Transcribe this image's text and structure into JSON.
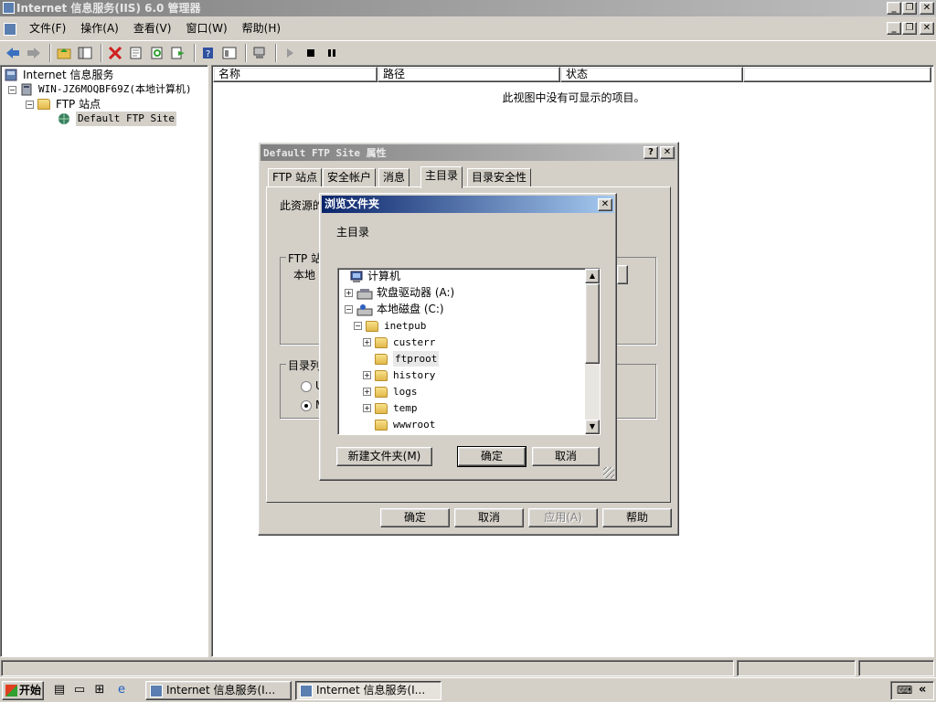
{
  "window": {
    "title": "Internet 信息服务(IIS) 6.0 管理器"
  },
  "menu": {
    "items": [
      "文件(F)",
      "操作(A)",
      "查看(V)",
      "窗口(W)",
      "帮助(H)"
    ]
  },
  "toolbar": {
    "icons": [
      "back-icon",
      "forward-icon",
      "up-folder-icon",
      "show-hide-tree-icon",
      "delete-icon",
      "properties-icon",
      "refresh-icon",
      "export-icon",
      "help-icon",
      "view-icon",
      "computer-icon",
      "start-icon",
      "stop-icon",
      "pause-icon"
    ]
  },
  "tree": {
    "root": "Internet 信息服务",
    "computer": "WIN-JZ6MOQBF69Z(本地计算机)",
    "ftp_sites": "FTP 站点",
    "default_site": "Default FTP Site"
  },
  "list": {
    "columns": [
      "名称",
      "路径",
      "状态"
    ],
    "empty_message": "此视图中没有可显示的项目。"
  },
  "properties_dialog": {
    "title": "Default FTP Site 属性",
    "tabs": [
      "FTP 站点",
      "安全帐户",
      "消息",
      "主目录",
      "目录安全性"
    ],
    "active_tab": "主目录",
    "resource_label": "此资源的",
    "group_ftp_label": "FTP 站",
    "local_path_label": "本地",
    "group_listing_label": "目录列",
    "radio_1_label": "U",
    "radio_2_label": "M",
    "buttons": {
      "ok": "确定",
      "cancel": "取消",
      "apply": "应用(A)",
      "help": "帮助"
    }
  },
  "browse_dialog": {
    "title": "浏览文件夹",
    "subtitle": "主目录",
    "nodes": {
      "computer": "计算机",
      "floppy": "软盘驱动器 (A:)",
      "local_disk": "本地磁盘 (C:)",
      "inetpub": "inetpub",
      "custerr": "custerr",
      "ftproot": "ftproot",
      "history": "history",
      "logs": "logs",
      "temp": "temp",
      "wwwroot": "wwwroot"
    },
    "selected": "ftproot",
    "buttons": {
      "new_folder": "新建文件夹(M)",
      "ok": "确定",
      "cancel": "取消"
    }
  },
  "taskbar": {
    "start": "开始",
    "tasks": [
      "Internet 信息服务(I...",
      "Internet 信息服务(I..."
    ],
    "active_task_index": 1
  },
  "colors": {
    "active_titlebar": "#0a246a",
    "inactive_titlebar": "#808080",
    "face": "#d4d0c8"
  }
}
